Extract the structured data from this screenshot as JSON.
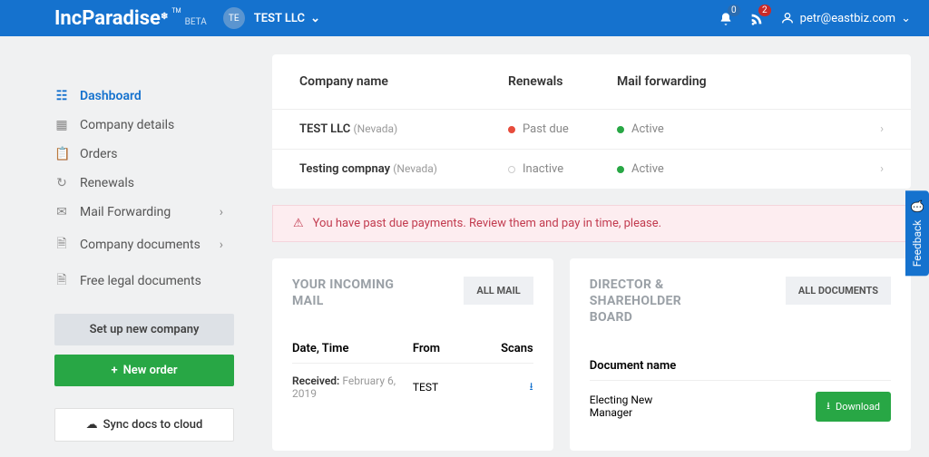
{
  "header": {
    "logo": "IncParadise",
    "beta": "BETA",
    "tm": "TM",
    "avatar_initials": "TE",
    "company_selected": "TEST LLC",
    "notif_count": "0",
    "feed_count": "2",
    "user_email": "petr@eastbiz.com"
  },
  "sidebar": {
    "items": [
      {
        "label": "Dashboard"
      },
      {
        "label": "Company details"
      },
      {
        "label": "Orders"
      },
      {
        "label": "Renewals"
      },
      {
        "label": "Mail Forwarding"
      },
      {
        "label": "Company documents"
      },
      {
        "label": "Free legal documents"
      }
    ],
    "setup_btn": "Set up new company",
    "new_order_btn": "New order",
    "sync_btn": "Sync docs to cloud"
  },
  "companies": {
    "headers": {
      "name": "Company name",
      "renewals": "Renewals",
      "mail": "Mail forwarding"
    },
    "rows": [
      {
        "name": "TEST LLC",
        "state": "(Nevada)",
        "renewals": "Past due",
        "mail": "Active"
      },
      {
        "name": "Testing compnay",
        "state": "(Nevada)",
        "renewals": "Inactive",
        "mail": "Active"
      }
    ]
  },
  "alert_text": "You have past due payments. Review them and pay in time, please.",
  "mail_panel": {
    "title": "YOUR INCOMING MAIL",
    "all_btn": "ALL MAIL",
    "headers": {
      "date": "Date, Time",
      "from": "From",
      "scans": "Scans"
    },
    "rows": [
      {
        "label": "Received:",
        "date": "February 6, 2019",
        "from": "TEST"
      }
    ]
  },
  "doc_panel": {
    "title": "DIRECTOR & SHAREHOLDER BOARD",
    "all_btn": "ALL DOCUMENTS",
    "header": "Document name",
    "rows": [
      {
        "name": "Electing New Manager"
      }
    ],
    "download": "Download"
  },
  "feedback_label": "Feedback"
}
